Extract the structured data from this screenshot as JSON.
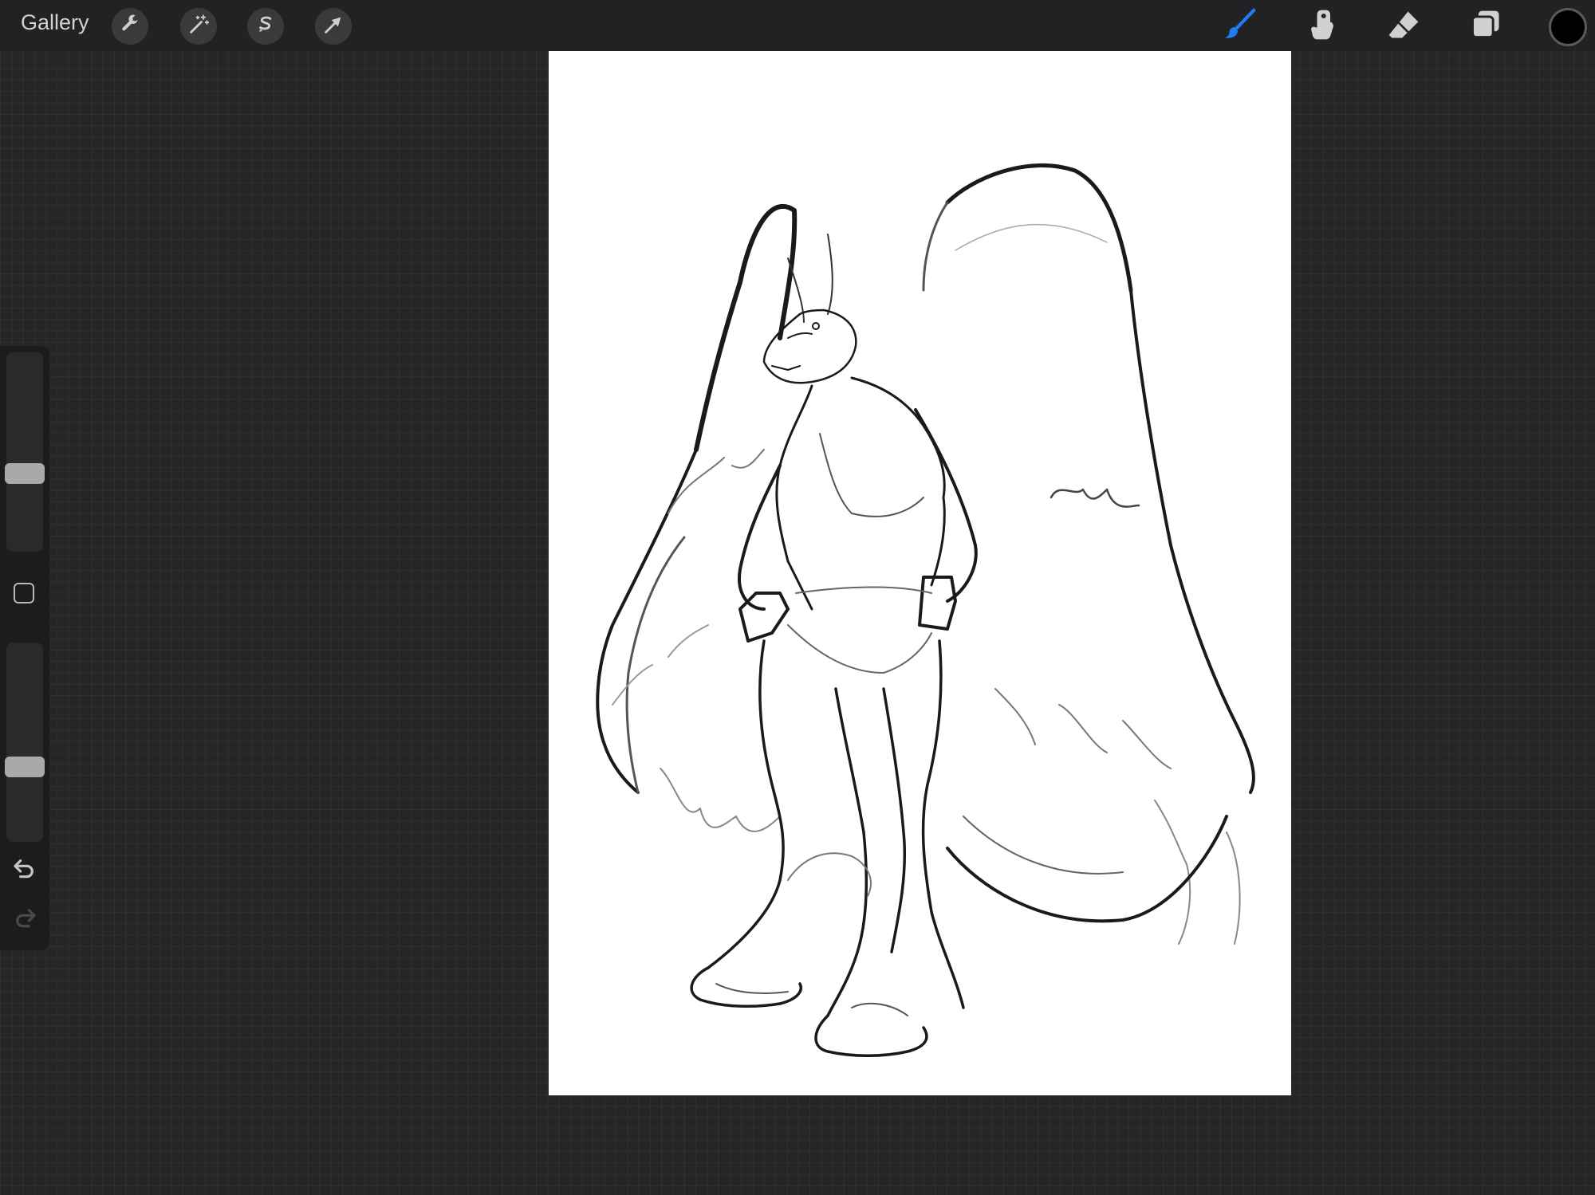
{
  "app": {
    "gallery_label": "Gallery"
  },
  "toolbar_left": {
    "icons": [
      "wrench-icon",
      "magic-wand-icon",
      "selection-s-icon",
      "transform-arrow-icon"
    ]
  },
  "toolbar_right": {
    "active_tool": "brush",
    "accent_color": "#1f7cf2",
    "icons": [
      "brush-icon",
      "smudge-icon",
      "eraser-icon",
      "layers-icon"
    ],
    "current_color": "#000000"
  },
  "sidebar": {
    "brush_size": 0.38,
    "brush_opacity": 0.36,
    "icons": [
      "modify-square-icon",
      "undo-icon",
      "redo-icon"
    ]
  },
  "canvas": {
    "background": "#ffffff",
    "content": "sketch"
  }
}
